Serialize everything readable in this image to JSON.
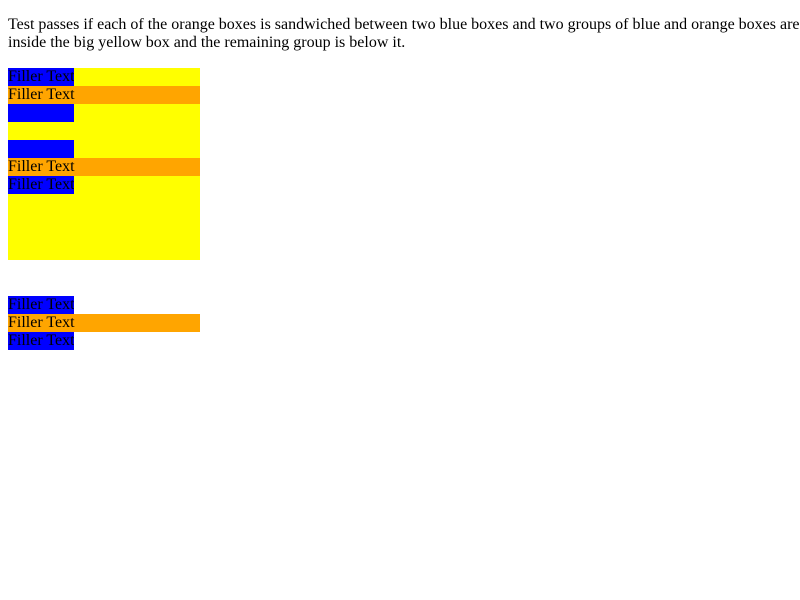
{
  "description": "Test passes if each of the orange boxes is sandwiched between two blue boxes and two groups of blue and orange boxes are inside the big yellow box and the remaining group is below it.",
  "colors": {
    "yellow": "#ffff00",
    "blue": "#0000ff",
    "orange": "#ffa500"
  },
  "groups": [
    {
      "top_label": "Filler Text",
      "middle_label": "Filler Text",
      "bottom_label": ""
    },
    {
      "top_label": "",
      "middle_label": "Filler Text",
      "bottom_label": "Filler Text"
    },
    {
      "top_label": "Filler Text",
      "middle_label": "Filler Text",
      "bottom_label": "Filler Text"
    }
  ]
}
